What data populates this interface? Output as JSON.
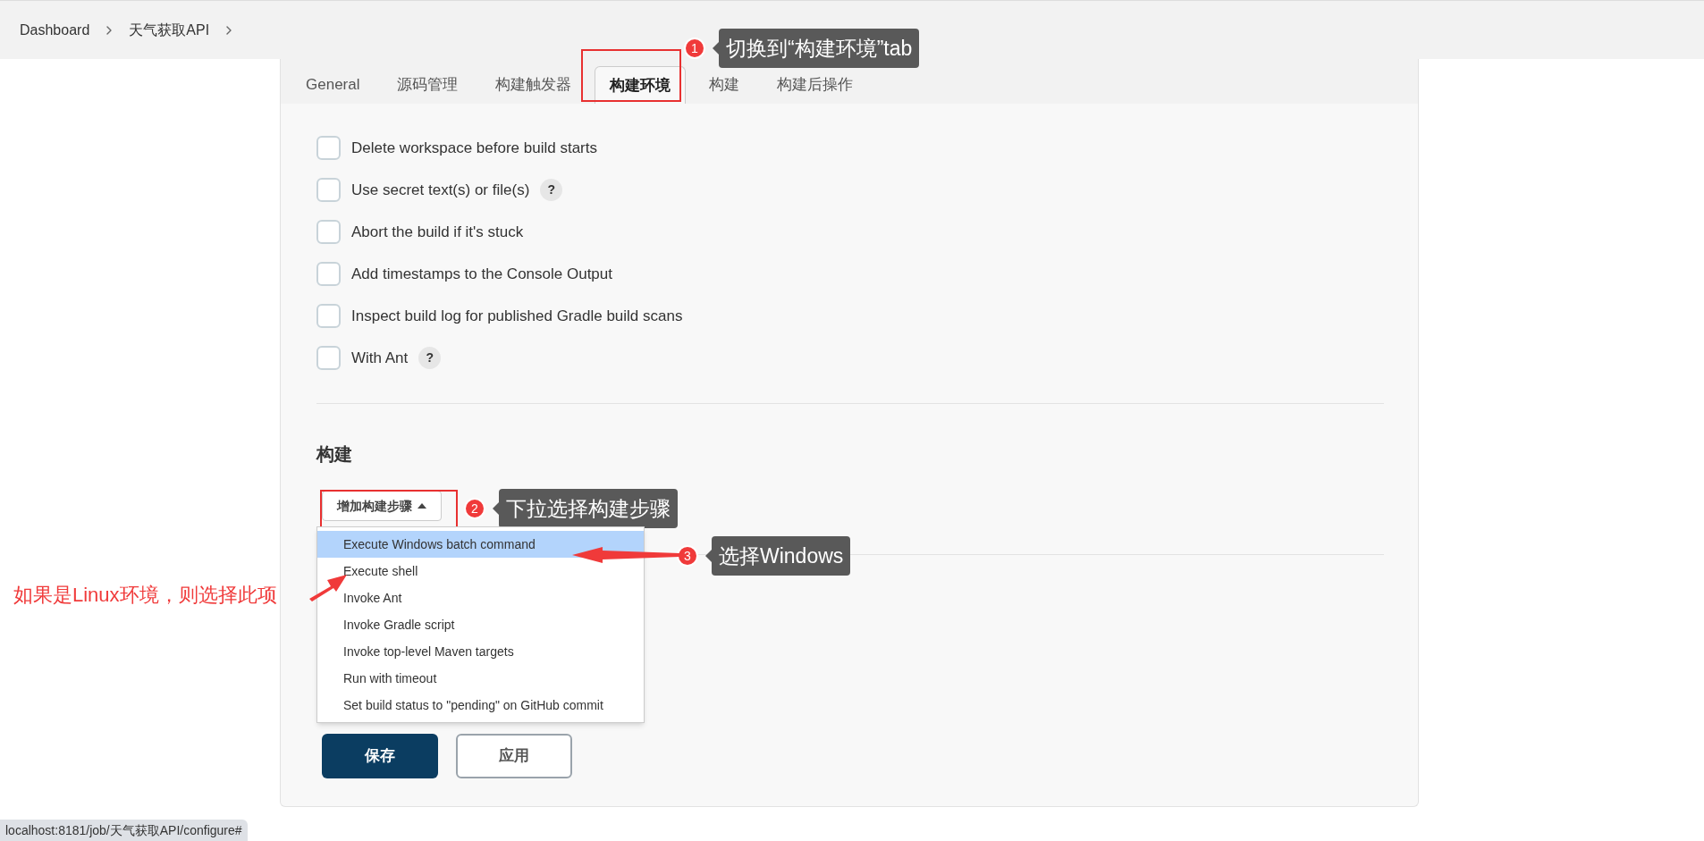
{
  "breadcrumb": [
    {
      "label": "Dashboard"
    },
    {
      "label": "天气获取API"
    }
  ],
  "tabs": [
    {
      "label": "General",
      "selected": false
    },
    {
      "label": "源码管理",
      "selected": false
    },
    {
      "label": "构建触发器",
      "selected": false
    },
    {
      "label": "构建环境",
      "selected": true
    },
    {
      "label": "构建",
      "selected": false
    },
    {
      "label": "构建后操作",
      "selected": false
    }
  ],
  "options": [
    {
      "label": "Delete workspace before build starts",
      "checked": false
    },
    {
      "label": "Use secret text(s) or file(s)",
      "checked": false,
      "help": "?"
    },
    {
      "label": "Abort the build if it's stuck",
      "checked": false
    },
    {
      "label": "Add timestamps to the Console Output",
      "checked": false
    },
    {
      "label": "Inspect build log for published Gradle build scans",
      "checked": false
    },
    {
      "label": "With Ant",
      "checked": false,
      "help": "?"
    }
  ],
  "section_title": "构建",
  "add_step_button": {
    "label": "增加构建步骤",
    "expanded": true
  },
  "dropdown_items": [
    {
      "label": "Execute Windows batch command",
      "selected": true
    },
    {
      "label": "Execute shell",
      "selected": false
    },
    {
      "label": "Invoke Ant",
      "selected": false
    },
    {
      "label": "Invoke Gradle script",
      "selected": false
    },
    {
      "label": "Invoke top-level Maven targets",
      "selected": false
    },
    {
      "label": "Run with timeout",
      "selected": false
    },
    {
      "label": "Set build status to \"pending\" on GitHub commit",
      "selected": false
    }
  ],
  "buttons": [
    {
      "label": "保存",
      "kind": "primary"
    },
    {
      "label": "应用",
      "kind": "secondary"
    }
  ],
  "status_url": "localhost:8181/job/天气获取API/configure#",
  "annotations": [
    {
      "number": "1",
      "text": "切换到“构建环境”tab"
    },
    {
      "number": "2",
      "text": "下拉选择构建步骤"
    },
    {
      "number": "3",
      "text": "选择Windows"
    }
  ],
  "side_note": "如果是Linux环境，则选择此项"
}
